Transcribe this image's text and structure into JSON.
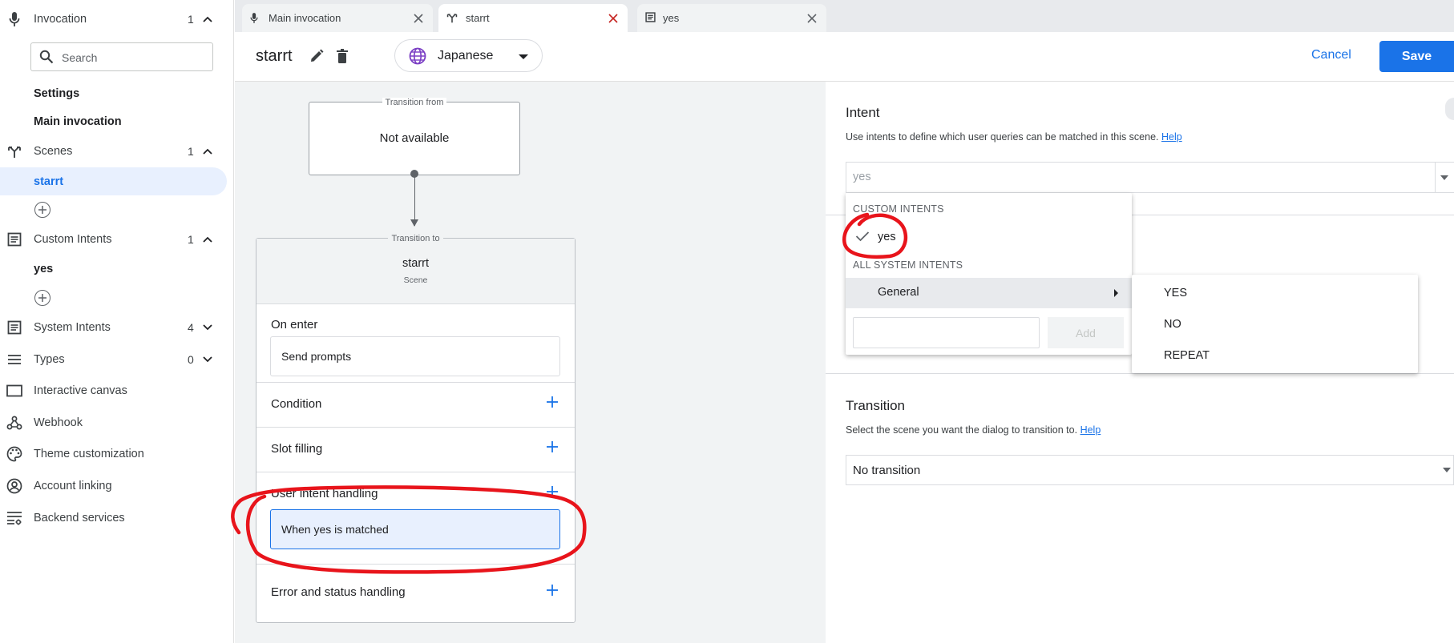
{
  "colors": {
    "accent": "#1a73e8",
    "annotation": "#e8141b",
    "selected_bg": "#e8f0fe"
  },
  "sidebar": {
    "search": {
      "placeholder": "Search",
      "value": ""
    },
    "sections": [
      {
        "label": "Invocation",
        "icon": "mic-icon",
        "count": "1",
        "expanded": true
      },
      {
        "label": "Scenes",
        "icon": "scenes-icon",
        "count": "1",
        "expanded": true
      },
      {
        "label": "Custom Intents",
        "icon": "list-icon",
        "count": "1",
        "expanded": true
      },
      {
        "label": "System Intents",
        "icon": "list-icon",
        "count": "4",
        "expanded": false
      },
      {
        "label": "Types",
        "icon": "types-icon",
        "count": "0",
        "expanded": false
      },
      {
        "label": "Interactive canvas",
        "icon": "canvas-icon"
      },
      {
        "label": "Webhook",
        "icon": "webhook-icon"
      },
      {
        "label": "Theme customization",
        "icon": "palette-icon"
      },
      {
        "label": "Account linking",
        "icon": "account-icon"
      },
      {
        "label": "Backend services",
        "icon": "backend-icon"
      }
    ],
    "invocation_items": [
      "Settings",
      "Main invocation"
    ],
    "scene_items": [
      "starrt"
    ],
    "custom_intent_items": [
      "yes"
    ]
  },
  "tabs": [
    {
      "label": "Main invocation",
      "icon": "mic-icon",
      "active": false
    },
    {
      "label": "starrt",
      "icon": "scenes-icon",
      "active": true
    },
    {
      "label": "yes",
      "icon": "list-icon",
      "active": false
    }
  ],
  "header": {
    "title": "starrt",
    "language": "Japanese",
    "cancel_label": "Cancel",
    "save_label": "Save"
  },
  "canvas": {
    "from_caption": "Transition from",
    "from_value": "Not available",
    "to_caption": "Transition to",
    "scene_name": "starrt",
    "scene_type": "Scene",
    "sections": {
      "on_enter": "On enter",
      "send_prompts": "Send prompts",
      "condition": "Condition",
      "slot_filling": "Slot filling",
      "user_intent_handling": "User intent handling",
      "when_matched": "When yes is matched",
      "error_status": "Error and status handling"
    }
  },
  "right_panel": {
    "intent_title": "Intent",
    "intent_desc": "Use intents to define which user queries can be matched in this scene.",
    "help_label": "Help",
    "intent_value": "yes",
    "transition_title": "Transition",
    "transition_desc": "Select the scene you want the dialog to transition to.",
    "transition_value": "No transition"
  },
  "intent_menu": {
    "custom_header": "CUSTOM INTENTS",
    "custom_items": [
      {
        "label": "yes",
        "checked": true
      }
    ],
    "system_header": "ALL SYSTEM INTENTS",
    "system_groups": [
      "General"
    ],
    "new_intent_placeholder": "",
    "add_label": "Add",
    "submenu_items": [
      "YES",
      "NO",
      "REPEAT"
    ]
  }
}
